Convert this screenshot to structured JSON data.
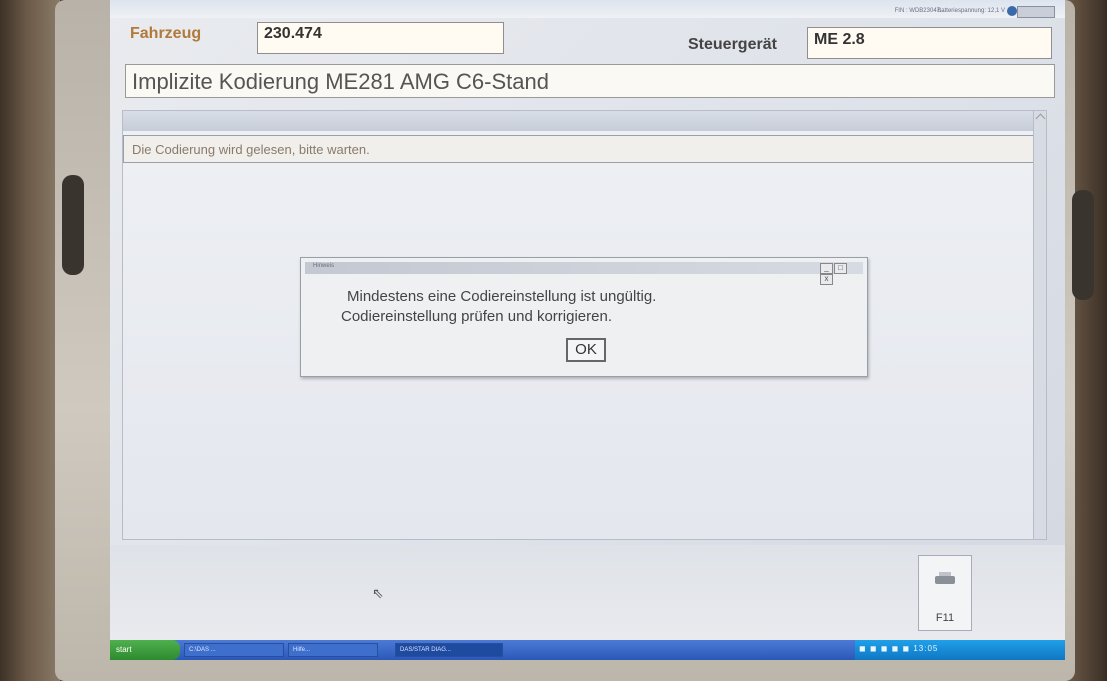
{
  "header": {
    "fahrzeug_label": "Fahrzeug",
    "fahrzeug_value": "230.474",
    "steuergeraet_label": "Steuergerät",
    "steuergeraet_value": "ME 2.8",
    "fin_text": "FIN : WDB23047...",
    "battery_text": "Batteriespannung: 12,1 V"
  },
  "page": {
    "title": "Implizite Kodierung ME281 AMG C6-Stand",
    "status_message": "Die Codierung wird gelesen, bitte warten."
  },
  "dialog": {
    "title": "Hinweis",
    "line1": "Mindestens eine Codiereinstellung ist ungültig.",
    "line2": "Codiereinstellung prüfen und korrigieren.",
    "ok_label": "OK",
    "controls": [
      "_",
      "□",
      "x"
    ]
  },
  "footer": {
    "f11_label": "F11",
    "f11_icon": "printer-icon"
  },
  "taskbar": {
    "start_label": "start",
    "items": [
      "C:\\DAS ...",
      "Hilfe...",
      "DAS/STAR DIAG..."
    ],
    "tray_text": "◼ ◼ ◼ ◼ ◼ 13:05"
  },
  "colors": {
    "label_brown": "#b07a3a",
    "screen_bg": "#e4e7ee",
    "taskbar_blue": "#2a58b8"
  }
}
